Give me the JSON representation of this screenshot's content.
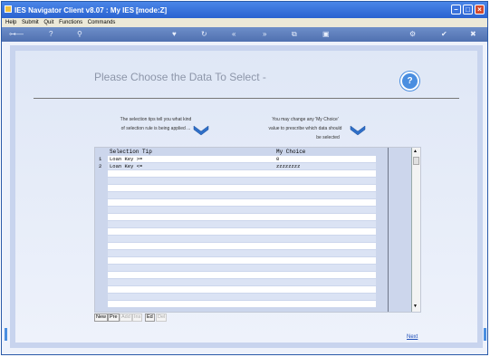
{
  "window": {
    "title": "IES Navigator Client v8.07 : My IES :",
    "mode": "[mode:Z]"
  },
  "menu": [
    "Help",
    "Submit",
    "Quit",
    "Functions",
    "Commands"
  ],
  "page": {
    "heading": "Please Choose the Data To Select -",
    "left_note_line1": "The selection tips tell you what kind",
    "left_note_line2": "of selection rule is being applied ...",
    "right_note_line1": "You may change any 'My Choice'",
    "right_note_line2": "value to prescribe which data should",
    "right_note_line3": "be selected"
  },
  "grid": {
    "col_tip": "Selection Tip",
    "col_choice": "My Choice",
    "rows": [
      {
        "num": "1",
        "tip": "Loan Key >=",
        "choice": "0"
      },
      {
        "num": "2",
        "tip": "Loan Key <=",
        "choice": "zzzzzzzz"
      }
    ],
    "empty_rows": 20
  },
  "footer_buttons": [
    {
      "label": "New",
      "enabled": true
    },
    {
      "label": "Pre",
      "enabled": true
    },
    {
      "label": "Add",
      "enabled": false
    },
    {
      "label": "Ins",
      "enabled": false
    },
    {
      "label": "Ed",
      "enabled": true
    },
    {
      "label": "Del",
      "enabled": false
    }
  ],
  "next_label": "Next",
  "colors": {
    "titlebar": "#2a62d0",
    "accent": "#4a8ee0",
    "link": "#1f4fb8"
  }
}
